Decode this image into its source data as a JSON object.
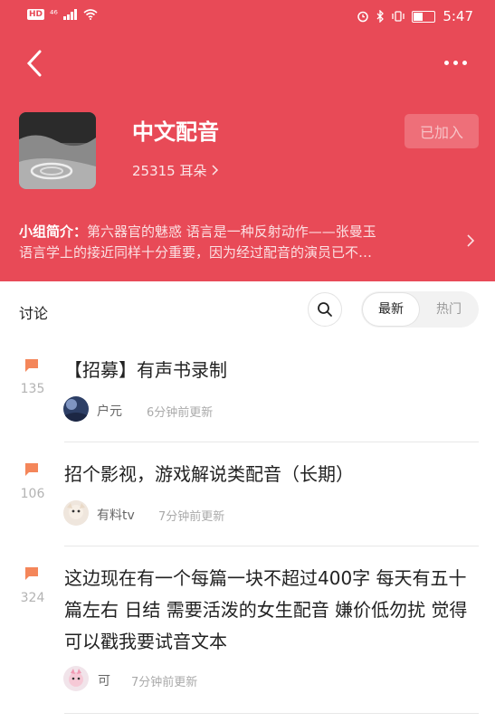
{
  "status_bar": {
    "badge": "HD",
    "network": "⁴⁶",
    "time": "5:47"
  },
  "group": {
    "name": "中文配音",
    "ears_count": "25315",
    "ears_unit": "耳朵",
    "joined_label": "已加入",
    "intro_label": "小组简介：",
    "intro_text": "第六器官的魅惑   语言是一种反射动作——张曼玉",
    "intro_text_2": "语言学上的接近同样十分重要，因为经过配音的演员已不…"
  },
  "section": {
    "title": "讨论",
    "sort_latest": "最新",
    "sort_hot": "热门"
  },
  "posts": [
    {
      "count": "135",
      "title": "【招募】有声书录制",
      "author": "户元",
      "time": "6分钟前更新"
    },
    {
      "count": "106",
      "title": "招个影视，游戏解说类配音（长期）",
      "author": "有料tv",
      "time": "7分钟前更新"
    },
    {
      "count": "324",
      "title": "这边现在有一个每篇一块不超过400字 每天有五十篇左右 日结 需要活泼的女生配音 嫌价低勿扰 觉得可以戳我要试音文本",
      "author": "可",
      "time": "7分钟前更新"
    }
  ],
  "colors": {
    "header_bg": "#e84a57",
    "flag": "#f4865a"
  }
}
